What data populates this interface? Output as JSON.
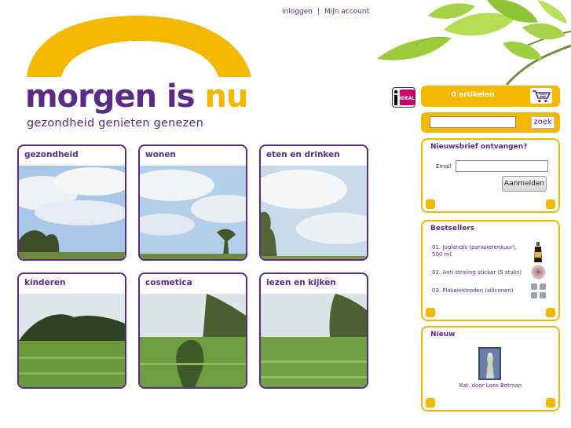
{
  "top_links": {
    "login": "inloggen",
    "separator": "|",
    "account": "Mijn account"
  },
  "logo": {
    "word1": "morgen is ",
    "word2": "nu",
    "tagline": "gezondheid genieten genezen"
  },
  "categories": [
    {
      "label": "gezondheid"
    },
    {
      "label": "wonen"
    },
    {
      "label": "eten en drinken"
    },
    {
      "label": "kinderen"
    },
    {
      "label": "cosmetica"
    },
    {
      "label": "lezen en kijken"
    }
  ],
  "payment": {
    "ideal_label": "iDEAL"
  },
  "cart": {
    "label": "0 artikelen",
    "icon": "shopping-cart-icon"
  },
  "search": {
    "placeholder": "",
    "button_label": "zoek"
  },
  "newsletter": {
    "title": "Nieuwsbrief ontvangen?",
    "email_label": "Email",
    "email_value": "",
    "button_label": "Aanmelden"
  },
  "bestsellers": {
    "title": "Bestsellers",
    "items": [
      {
        "label": "01. Juglandis (parasietenkuur), 500 ml."
      },
      {
        "label": "02. Anti straling sticker (5 stuks)"
      },
      {
        "label": "03. Plakelektroden (siliconen)"
      }
    ]
  },
  "new": {
    "title": "Nieuw",
    "caption": "Kat. door Loes Botman"
  },
  "colors": {
    "brand_purple": "#5b2a86",
    "brand_yellow": "#f5b800"
  }
}
